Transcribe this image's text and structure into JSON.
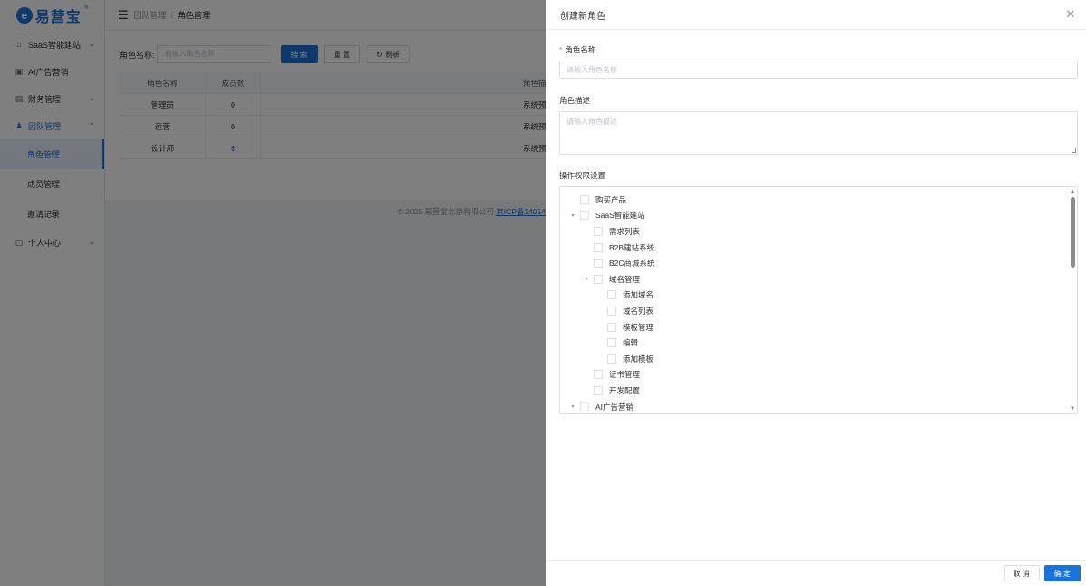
{
  "logo": {
    "mark": "e",
    "text": "易营宝",
    "sup": "®"
  },
  "sidebar": {
    "items": [
      {
        "icon": "⌂",
        "label": "SaaS智能建站",
        "arrow": "⌄"
      },
      {
        "icon": "▣",
        "label": "AI广告营销",
        "arrow": ""
      },
      {
        "icon": "▤",
        "label": "财务管理",
        "arrow": "⌄"
      },
      {
        "icon": "♟",
        "label": "团队管理",
        "arrow": "⌃"
      },
      {
        "icon": "▢",
        "label": "个人中心",
        "arrow": "⌄"
      }
    ],
    "submenu": [
      {
        "label": "角色管理"
      },
      {
        "label": "成员管理"
      },
      {
        "label": "邀请记录"
      }
    ]
  },
  "header": {
    "menu_icon": "☰",
    "breadcrumb_parent": "团队管理",
    "breadcrumb_sep": "/",
    "breadcrumb_current": "角色管理"
  },
  "search": {
    "label": "角色名称:",
    "placeholder": "请输入角色名称",
    "search_btn": "搜 索",
    "reset_btn": "重 置",
    "refresh_icon": "↻",
    "refresh_btn": "刷新"
  },
  "table": {
    "headers": [
      "角色名称",
      "成员数",
      "角色描述"
    ],
    "rows": [
      {
        "name": "管理员",
        "count": "0",
        "desc": "系统预设"
      },
      {
        "name": "运营",
        "count": "0",
        "desc": "系统预设"
      },
      {
        "name": "设计师",
        "count": "6",
        "desc": "系统预设"
      }
    ]
  },
  "footer": {
    "copyright": "© 2025 易营宝北京有限公司",
    "icp": "京ICP备14054"
  },
  "drawer": {
    "title": "创建新角色",
    "close_icon": "✕",
    "name_label": "角色名称",
    "name_required_mark": "*",
    "name_placeholder": "请输入角色名称",
    "desc_label": "角色描述",
    "desc_placeholder": "请输入角色描述",
    "perm_label": "操作权限设置",
    "tree": [
      {
        "label": "购买产品",
        "level": 0,
        "caret": ""
      },
      {
        "label": "SaaS智能建站",
        "level": 0,
        "caret": "▾"
      },
      {
        "label": "需求列表",
        "level": 1,
        "caret": ""
      },
      {
        "label": "B2B建站系统",
        "level": 1,
        "caret": ""
      },
      {
        "label": "B2C商城系统",
        "level": 1,
        "caret": ""
      },
      {
        "label": "域名管理",
        "level": 1,
        "caret": "▾"
      },
      {
        "label": "添加域名",
        "level": 2,
        "caret": ""
      },
      {
        "label": "域名列表",
        "level": 2,
        "caret": ""
      },
      {
        "label": "模板管理",
        "level": 2,
        "caret": ""
      },
      {
        "label": "编辑",
        "level": 2,
        "caret": ""
      },
      {
        "label": "添加模板",
        "level": 2,
        "caret": ""
      },
      {
        "label": "证书管理",
        "level": 1,
        "caret": ""
      },
      {
        "label": "开发配置",
        "level": 1,
        "caret": ""
      },
      {
        "label": "AI广告营销",
        "level": 0,
        "caret": "▾"
      }
    ],
    "scroll_up": "▲",
    "scroll_down": "▼",
    "cancel_btn": "取 消",
    "confirm_btn": "确 定"
  }
}
